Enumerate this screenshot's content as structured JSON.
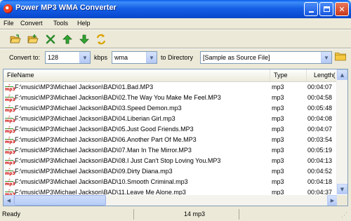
{
  "window": {
    "title": "Power MP3 WMA Converter",
    "controls": [
      "minimize",
      "maximize",
      "close"
    ]
  },
  "menu": {
    "items": [
      "File",
      "Convert",
      "Tools",
      "Help"
    ]
  },
  "toolbar": {
    "tools": [
      "open-folder-icon",
      "add-files-icon",
      "delete-icon",
      "move-up-icon",
      "move-down-icon",
      "convert-icon"
    ]
  },
  "convert_bar": {
    "convert_to_label": "Convert to:",
    "bitrate_value": "128",
    "kbps_label": "kbps",
    "format_value": "wma",
    "to_directory_label": "to Directory",
    "directory_value": "[Sample as Source File]"
  },
  "list": {
    "columns": [
      "FileName",
      "Type",
      "Length("
    ],
    "rows": [
      {
        "name": "F:\\music\\MP3\\Michael Jackson\\BAD\\01.Bad.MP3",
        "type": "mp3",
        "length": "00:04:07"
      },
      {
        "name": "F:\\music\\MP3\\Michael Jackson\\BAD\\02.The Way You Make Me Feel.MP3",
        "type": "mp3",
        "length": "00:04:58"
      },
      {
        "name": "F:\\music\\MP3\\Michael Jackson\\BAD\\03.Speed Demon.mp3",
        "type": "mp3",
        "length": "00:05:48"
      },
      {
        "name": "F:\\music\\MP3\\Michael Jackson\\BAD\\04.Liberian Girl.mp3",
        "type": "mp3",
        "length": "00:04:08"
      },
      {
        "name": "F:\\music\\MP3\\Michael Jackson\\BAD\\05.Just Good Friends.MP3",
        "type": "mp3",
        "length": "00:04:07"
      },
      {
        "name": "F:\\music\\MP3\\Michael Jackson\\BAD\\06.Another Part Of Me.MP3",
        "type": "mp3",
        "length": "00:03:54"
      },
      {
        "name": "F:\\music\\MP3\\Michael Jackson\\BAD\\07.Man In The Mirror.MP3",
        "type": "mp3",
        "length": "00:05:19"
      },
      {
        "name": "F:\\music\\MP3\\Michael Jackson\\BAD\\08.I Just Can't Stop Loving You.MP3",
        "type": "mp3",
        "length": "00:04:13"
      },
      {
        "name": "F:\\music\\MP3\\Michael Jackson\\BAD\\09.Dirty Diana.mp3",
        "type": "mp3",
        "length": "00:04:52"
      },
      {
        "name": "F:\\music\\MP3\\Michael Jackson\\BAD\\10.Smooth Criminal.mp3",
        "type": "mp3",
        "length": "00:04:18"
      },
      {
        "name": "F:\\music\\MP3\\Michael Jackson\\BAD\\11.Leave Me Alone.mp3",
        "type": "mp3",
        "length": "00:04:37"
      }
    ]
  },
  "status": {
    "left": "Ready",
    "center": "14 mp3"
  },
  "colors": {
    "titlebar": "#0b4fd6",
    "face": "#ece9d8",
    "close_button": "#c8391c"
  }
}
